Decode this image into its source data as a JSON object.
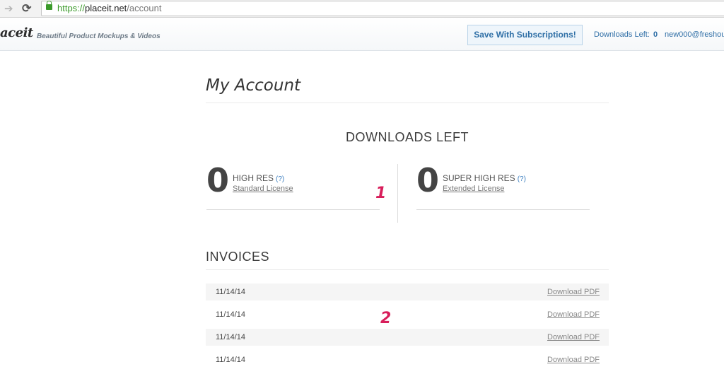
{
  "browser": {
    "url_scheme": "https://",
    "url_host": "placeit.net",
    "url_path": "/account"
  },
  "header": {
    "logo": "aceit",
    "tagline": "Beautiful Product Mockups & Videos",
    "subscribe_label": "Save With Subscriptions!",
    "downloads_left_label": "Downloads Left:",
    "downloads_left_count": "0",
    "user_email": "new000@freshou"
  },
  "page": {
    "title": "My Account",
    "downloads_heading": "DOWNLOADS LEFT",
    "panels": [
      {
        "count": "0",
        "title": "HIGH RES",
        "help": "(?)",
        "license": "Standard License"
      },
      {
        "count": "0",
        "title": "SUPER HIGH RES",
        "help": "(?)",
        "license": "Extended License"
      }
    ],
    "markers": [
      "1",
      "2"
    ],
    "invoices_heading": "INVOICES",
    "invoices": [
      {
        "date": "11/14/14",
        "action": "Download PDF"
      },
      {
        "date": "11/14/14",
        "action": "Download PDF"
      },
      {
        "date": "11/14/14",
        "action": "Download PDF"
      },
      {
        "date": "11/14/14",
        "action": "Download PDF"
      }
    ]
  },
  "colors": {
    "link": "#2f6fa6",
    "marker": "#d81e5b",
    "secure": "#3b9a2a"
  }
}
